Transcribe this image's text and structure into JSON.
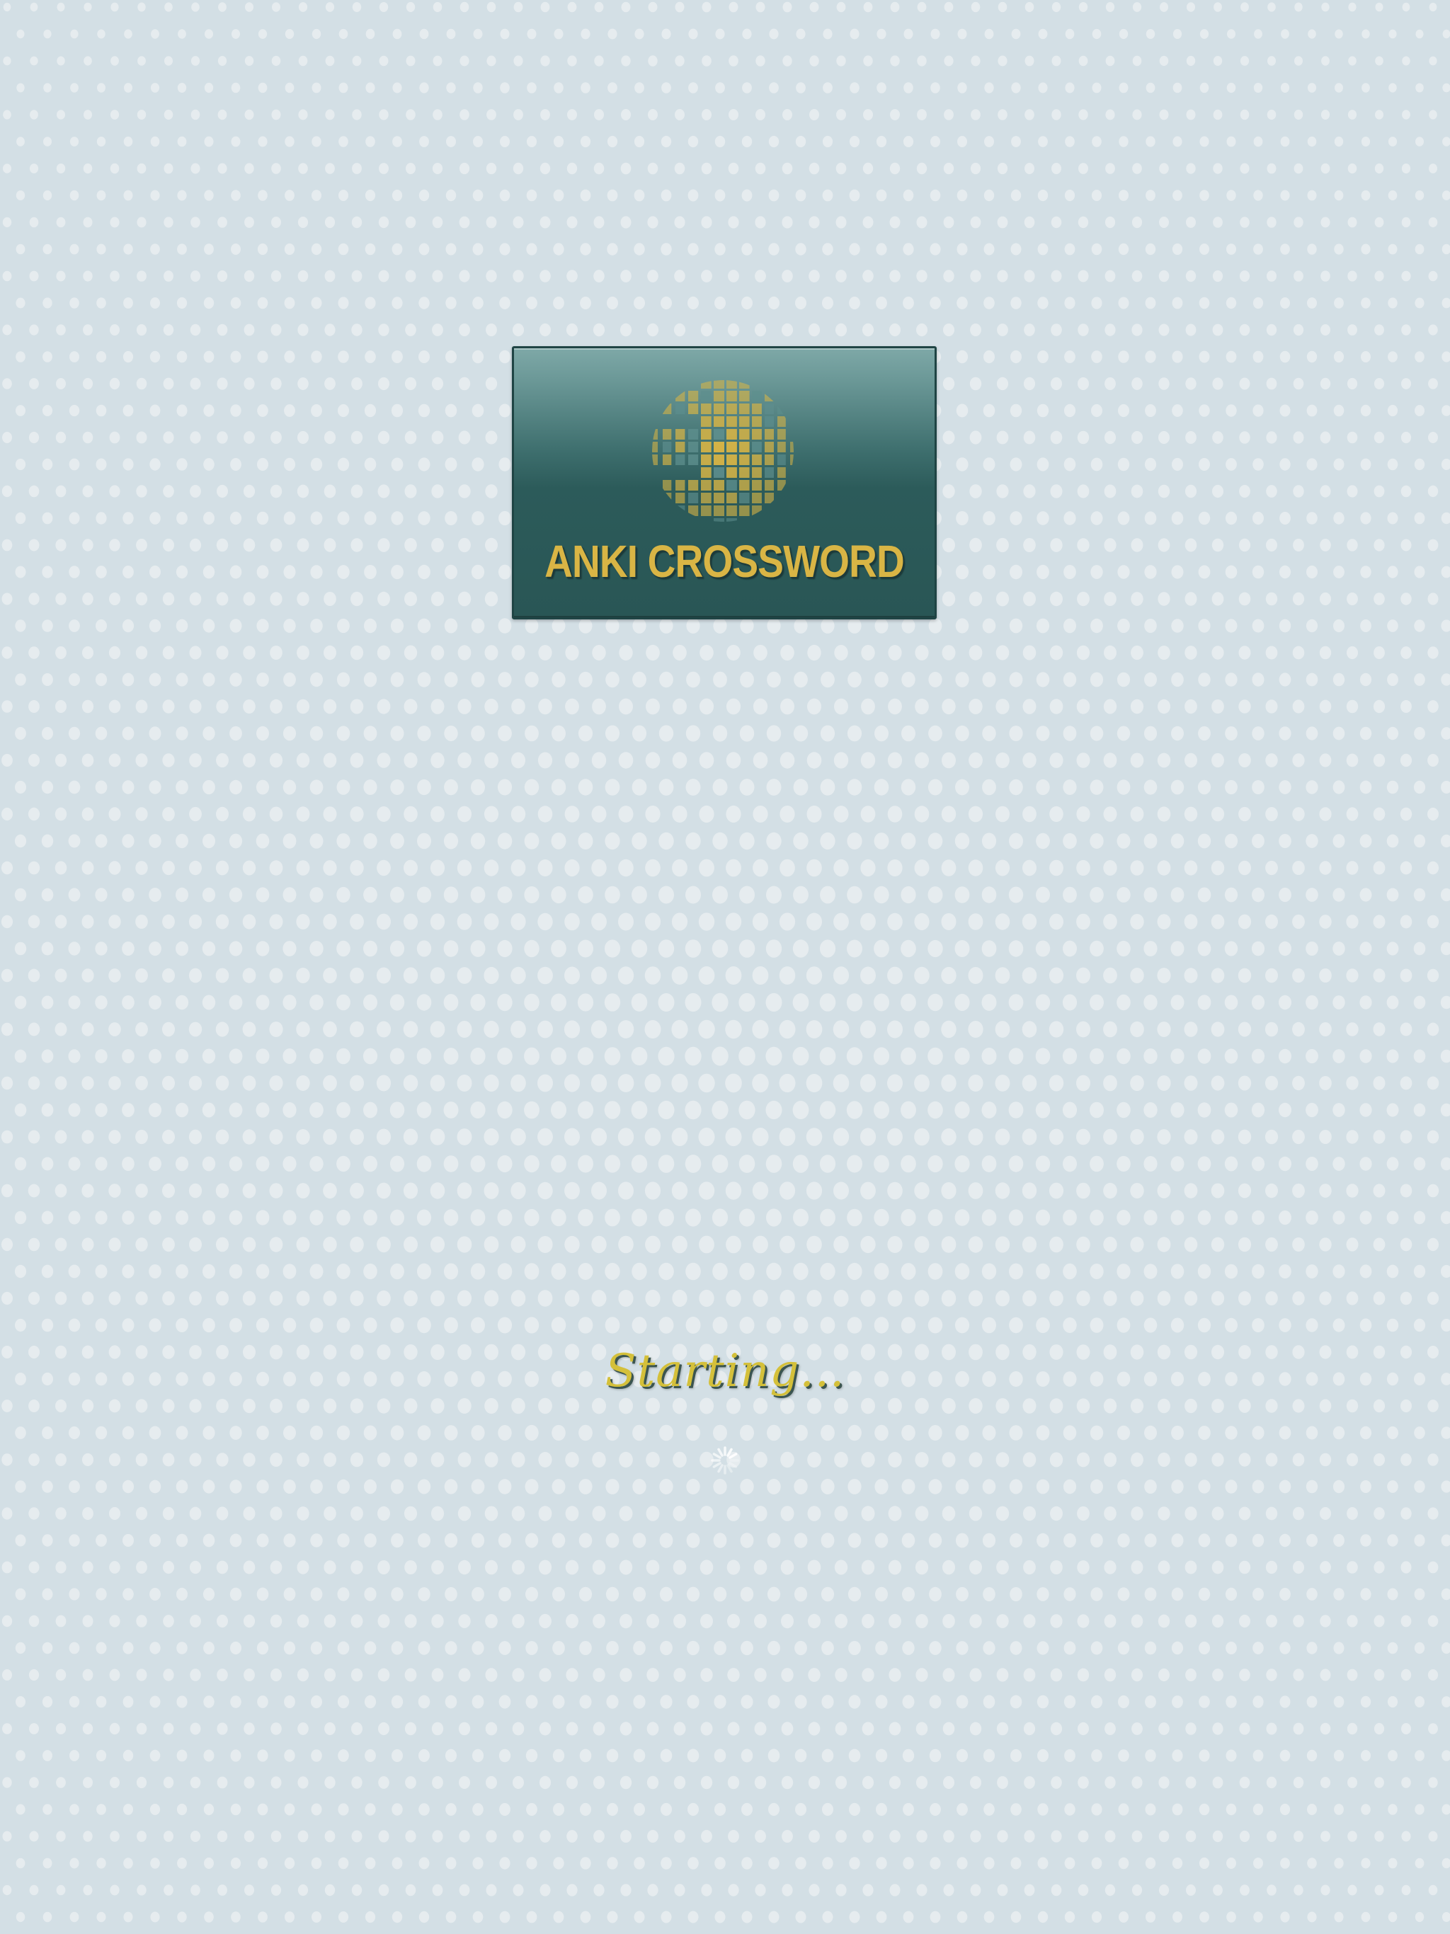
{
  "splash": {
    "logo": {
      "wordmark": "ANKI CROSSWORD",
      "icon": "globe-crossword-icon",
      "colors": {
        "card_top": "#7ea8a7",
        "card_bottom": "#295655",
        "gold": "#d9b545"
      }
    },
    "status_text": "Starting...",
    "spinner": {
      "icon": "loading-spinner-icon"
    }
  },
  "background": {
    "color": "#d3dfe5",
    "dot_color": "#e6ecef"
  }
}
